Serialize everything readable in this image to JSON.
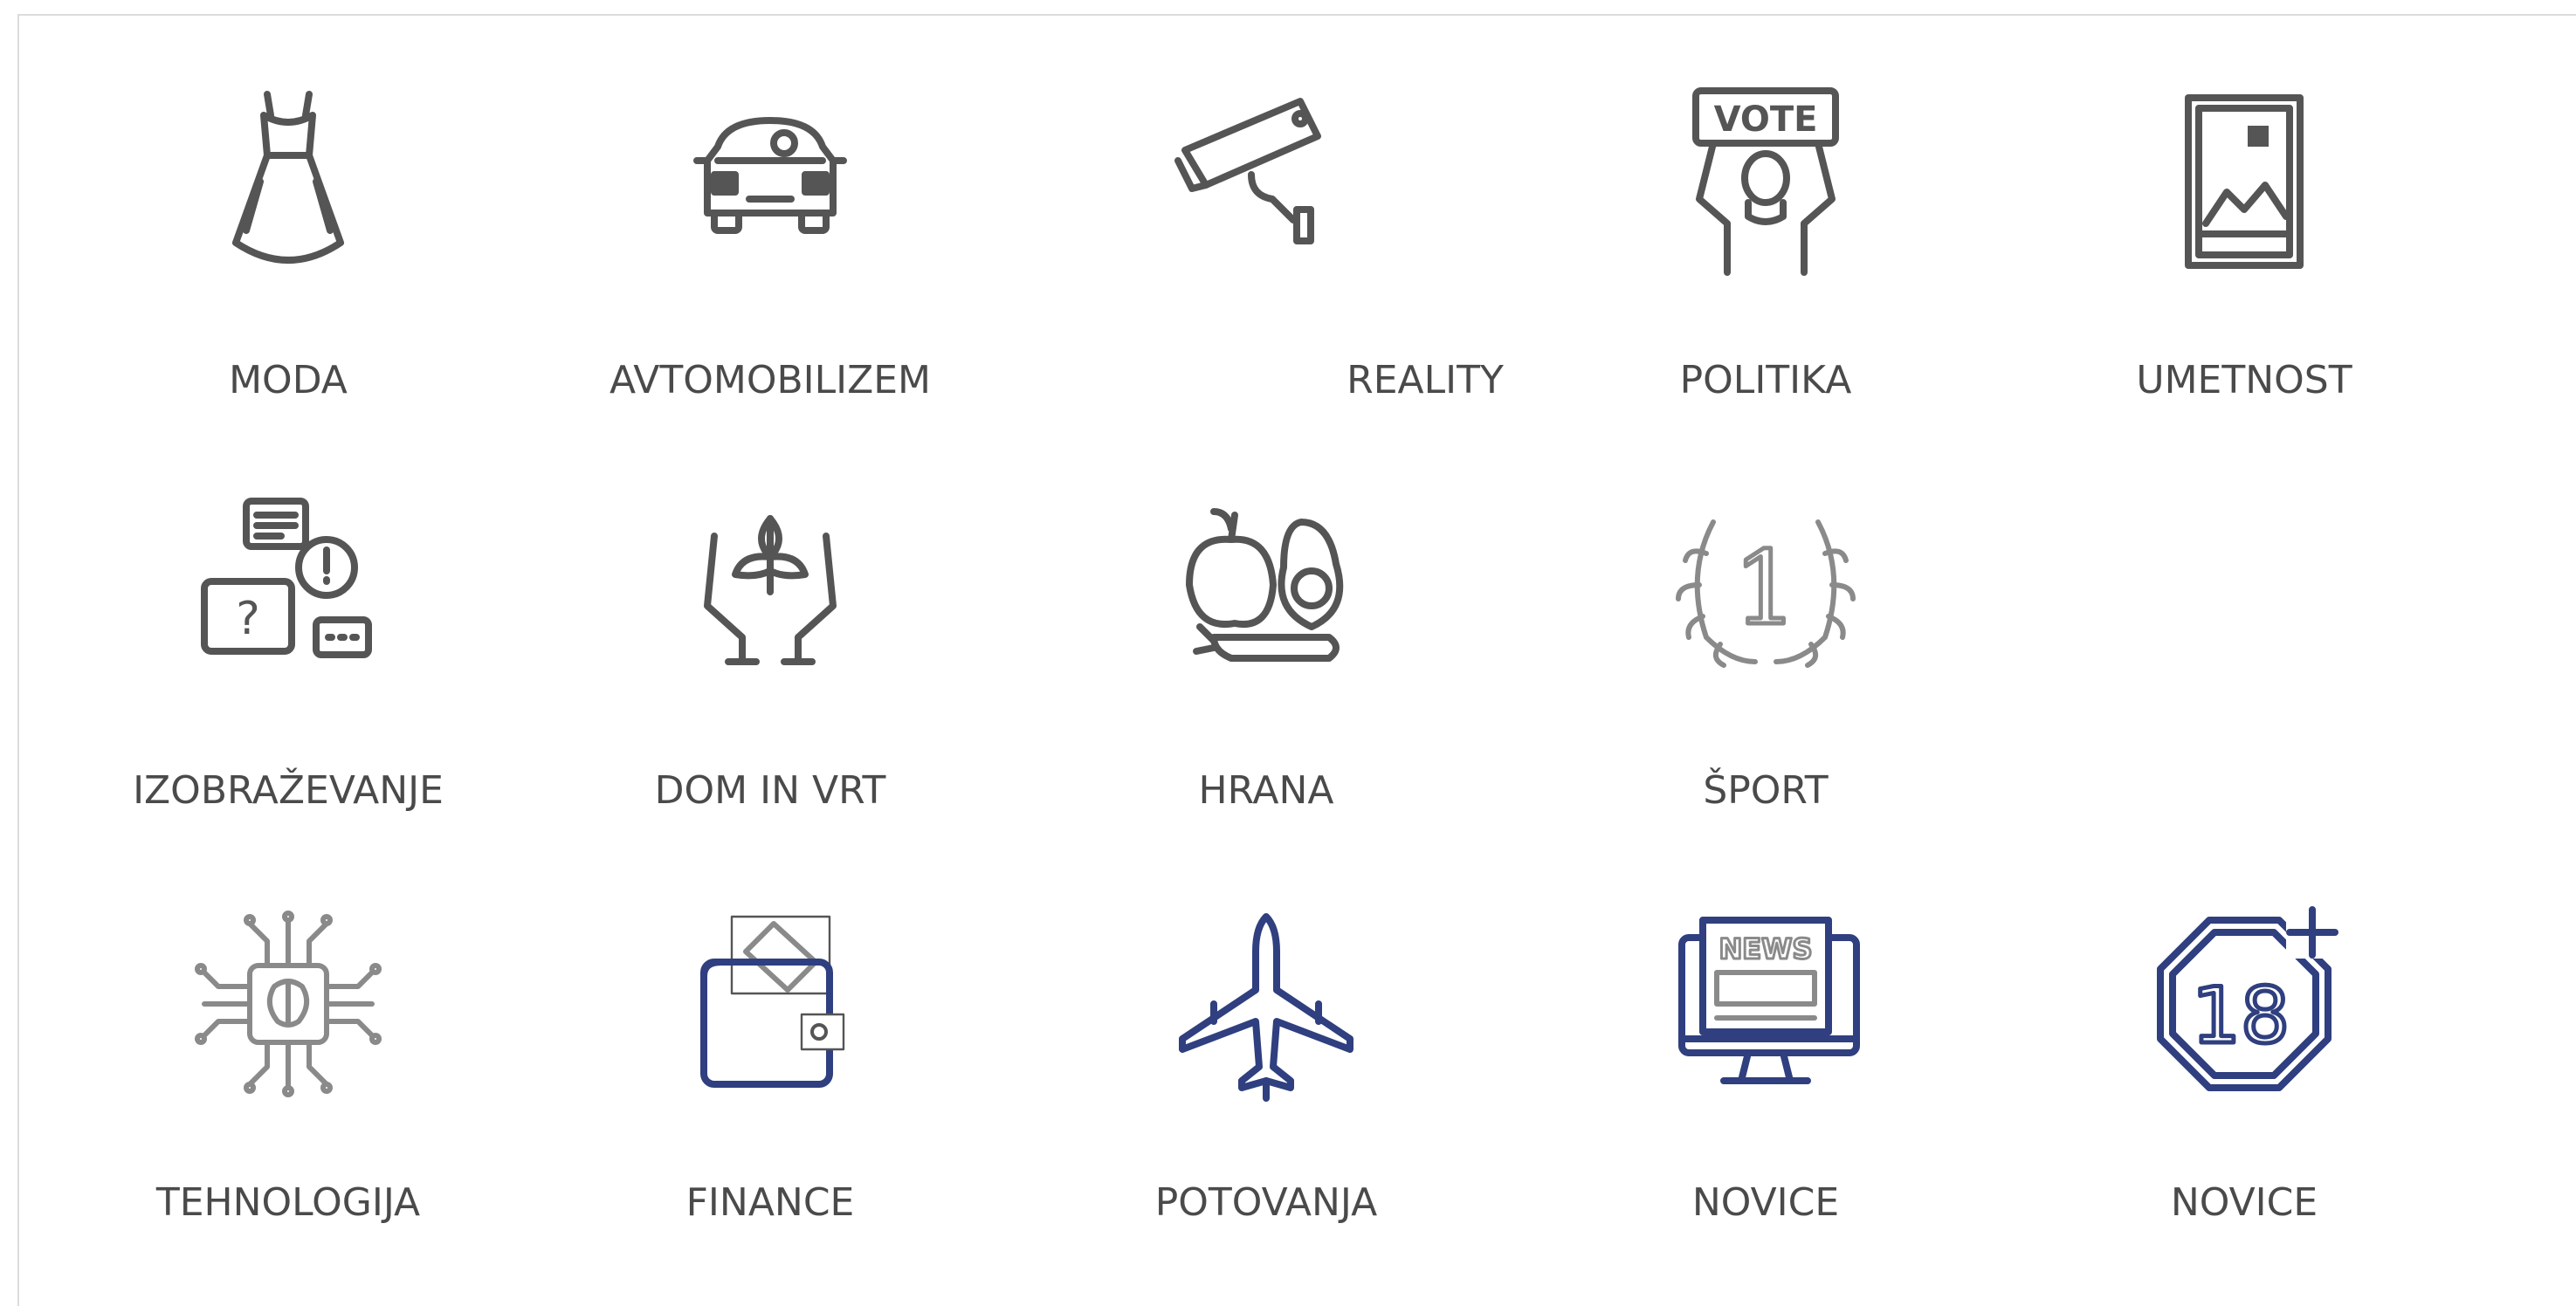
{
  "categories": [
    {
      "label": "MODA",
      "icon": "dress-icon"
    },
    {
      "label": "AVTOMOBILIZEM",
      "icon": "car-icon"
    },
    {
      "label": "REALITY",
      "icon": "security-camera-icon"
    },
    {
      "label": "POLITIKA",
      "icon": "vote-protester-icon"
    },
    {
      "label": "UMETNOST",
      "icon": "framed-picture-icon"
    },
    {
      "label": "IZOBRAŽEVANJE",
      "icon": "speech-bubbles-question-icon"
    },
    {
      "label": "DOM IN VRT",
      "icon": "hands-plant-icon"
    },
    {
      "label": "HRANA",
      "icon": "fruit-vegetables-icon"
    },
    {
      "label": "ŠPORT",
      "icon": "laurel-number-one-icon"
    },
    {
      "label": "TEHNOLOGIJA",
      "icon": "chip-brain-icon"
    },
    {
      "label": "FINANCE",
      "icon": "wallet-icon"
    },
    {
      "label": "POTOVANJA",
      "icon": "airplane-icon"
    },
    {
      "label": "NOVICE",
      "icon": "news-monitor-icon"
    },
    {
      "label": "NOVICE",
      "icon": "eighteen-plus-icon"
    }
  ],
  "icon_text": {
    "vote_sign": "VOTE",
    "rank": "1",
    "news_banner": "NEWS",
    "age_limit": "18"
  },
  "colors": {
    "icon_gray": "#555555",
    "icon_light_gray": "#8a8a8a",
    "icon_navy": "#2f3f7f",
    "label": "#4a4a4a",
    "border": "#dcdcdc"
  }
}
